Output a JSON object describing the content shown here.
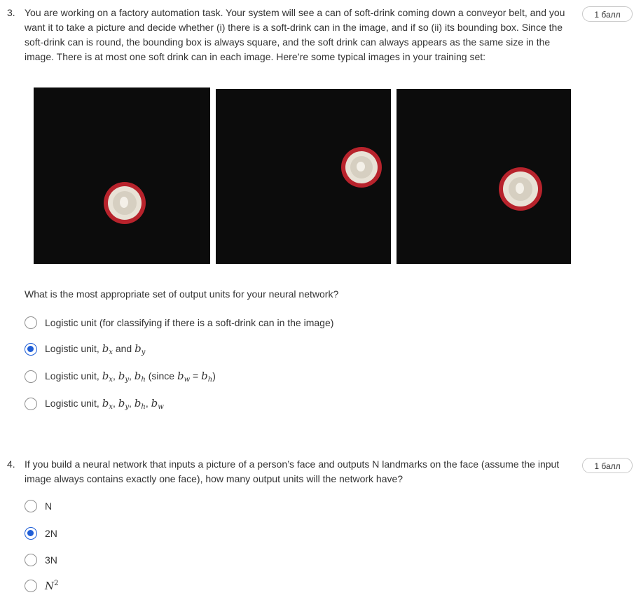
{
  "questions": [
    {
      "number": "3.",
      "points": "1 балл",
      "text": "You are working on a factory automation task. Your system will see a can of soft-drink coming down a conveyor belt, and you want it to take a picture and decide whether (i) there is a soft-drink can in the image, and if so (ii) its bounding box. Since the soft-drink can is round, the bounding box is always square, and the soft drink can always appears as the same size in the image. There is at most one soft drink can in each image. Here’re some typical images in your training set:",
      "prompt": "What is the most appropriate set of output units for your neural network?",
      "options": [
        {
          "text": "Logistic unit (for classifying if there is a soft-drink can in the image)",
          "selected": false
        },
        {
          "text_a": "Logistic unit, ",
          "m1": "b",
          "s1": "x",
          "text_b": " and ",
          "m2": "b",
          "s2": "y",
          "selected": true
        },
        {
          "text_a": "Logistic unit, ",
          "vars": "b",
          "s1": "x",
          "s2": "y",
          "s3": "h",
          "paren_open": " (since ",
          "eq": " = ",
          "sw": "w",
          "sh": "h",
          "paren_close": ")",
          "selected": false
        },
        {
          "text_a": "Logistic unit, ",
          "s1": "x",
          "s2": "y",
          "s3": "h",
          "s4": "w",
          "selected": false
        }
      ]
    },
    {
      "number": "4.",
      "points": "1 балл",
      "text": "If you build a neural network that inputs a picture of a person’s face and outputs N landmarks on the face (assume the input image always contains exactly one face), how many output units will the network have?",
      "options": [
        {
          "text": "N",
          "selected": false
        },
        {
          "text": "2N",
          "selected": true
        },
        {
          "text": "3N",
          "selected": false
        },
        {
          "base": "N",
          "exp": "2",
          "selected": false
        }
      ]
    }
  ],
  "colors": {
    "accent": "#1f5ed6",
    "image_bg": "#0b0b0b",
    "can_red": "#b8232c",
    "can_silver": "#e8e2d6"
  }
}
